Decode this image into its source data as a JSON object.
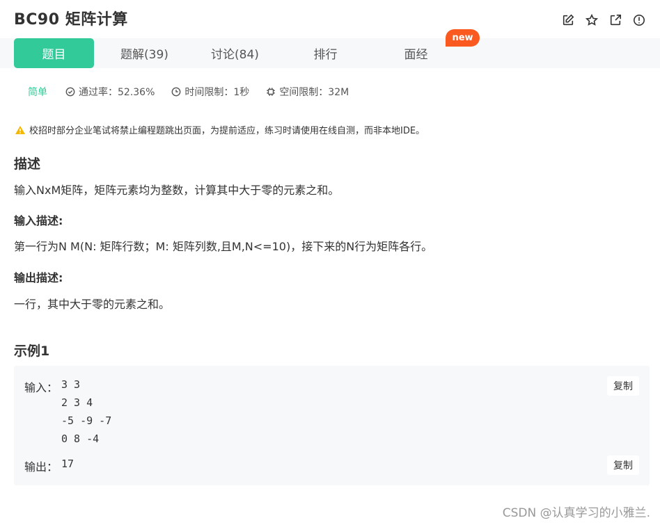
{
  "header": {
    "title": "BC90  矩阵计算"
  },
  "tabs": [
    {
      "label": "题目",
      "active": true
    },
    {
      "label": "题解(39)",
      "active": false
    },
    {
      "label": "讨论(84)",
      "active": false
    },
    {
      "label": "排行",
      "active": false
    },
    {
      "label": "面经",
      "active": false
    }
  ],
  "new_badge": "new",
  "meta": {
    "difficulty": "简单",
    "pass_rate": "通过率：52.36%",
    "time_limit": "时间限制：1秒",
    "space_limit": "空间限制：32M"
  },
  "warning": "校招时部分企业笔试将禁止编程题跳出页面，为提前适应，练习时请使用在线自测，而非本地IDE。",
  "description": {
    "title": "描述",
    "text": "输入NxM矩阵，矩阵元素均为整数，计算其中大于零的元素之和。"
  },
  "input_desc": {
    "title": "输入描述:",
    "text": "第一行为N M(N: 矩阵行数；M: 矩阵列数,且M,N<=10)，接下来的N行为矩阵各行。"
  },
  "output_desc": {
    "title": "输出描述:",
    "text": "一行，其中大于零的元素之和。"
  },
  "example": {
    "title": "示例1",
    "input_label": "输入：",
    "input_lines": [
      "3 3",
      "2 3 4",
      "-5 -9 -7",
      "0 8 -4"
    ],
    "output_label": "输出：",
    "output_value": "17",
    "copy_label": "复制"
  },
  "watermark": "CSDN @认真学习的小雅兰.",
  "colors": {
    "accent": "#32ca99",
    "badge": "#fa5a1f",
    "warning": "#f5b800"
  },
  "icons": [
    "edit-icon",
    "star-icon",
    "external-link-icon",
    "info-icon",
    "check-circle-icon",
    "clock-icon",
    "chip-icon",
    "warning-icon"
  ]
}
